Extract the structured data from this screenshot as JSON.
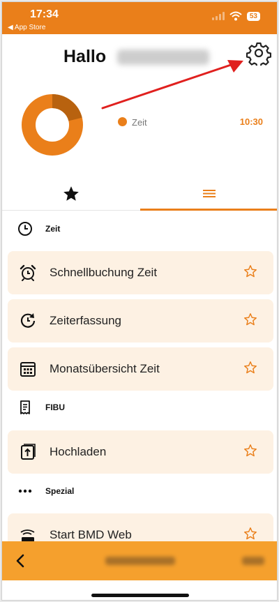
{
  "status": {
    "time": "17:34",
    "back_label": "◀ App Store",
    "battery": "53"
  },
  "header": {
    "greeting": "Hallo"
  },
  "chart_data": {
    "type": "pie",
    "categories": [
      "Zeit"
    ],
    "values": [
      "10:30"
    ],
    "legend": "right"
  },
  "summary": {
    "legend_label": "Zeit",
    "legend_value": "10:30"
  },
  "tabs": [
    {
      "name": "favorites",
      "active": false
    },
    {
      "name": "menu",
      "active": true
    }
  ],
  "sections": {
    "zeit": "Zeit",
    "fibu": "FIBU",
    "spezial": "Spezial"
  },
  "items": {
    "schnellbuchung": "Schnellbuchung Zeit",
    "zeiterfassung": "Zeiterfassung",
    "monatsuebersicht": "Monatsübersicht Zeit",
    "hochladen": "Hochladen",
    "bmd_web": "Start BMD Web"
  },
  "colors": {
    "accent": "#ea7f1a",
    "accent_light": "#f5a02d",
    "item_bg": "#fdf1e3",
    "annotation": "#e0201e"
  }
}
